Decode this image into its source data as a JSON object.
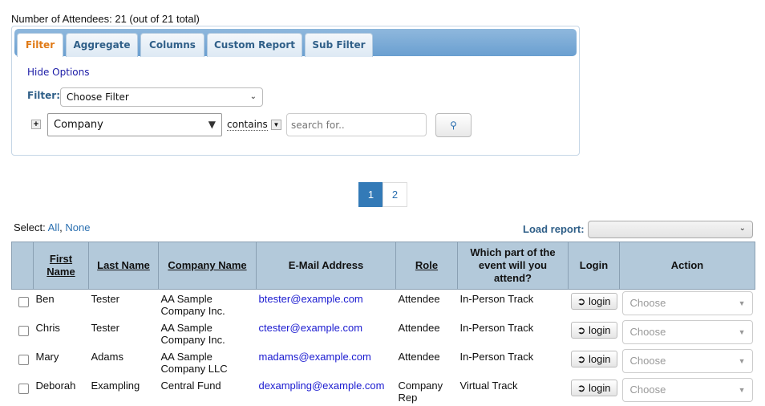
{
  "header": {
    "count_text": "Number of Attendees: 21 (out of 21 total)"
  },
  "tabs": [
    {
      "label": "Filter"
    },
    {
      "label": "Aggregate"
    },
    {
      "label": "Columns"
    },
    {
      "label": "Custom Report"
    },
    {
      "label": "Sub Filter"
    }
  ],
  "filter": {
    "hide_options": "Hide Options",
    "filter_label": "Filter:",
    "choose_filter": "Choose Filter",
    "field": "Company",
    "operator": "contains",
    "search_placeholder": "search for.."
  },
  "pagination": {
    "pages": [
      "1",
      "2"
    ],
    "current": "1"
  },
  "select": {
    "label": "Select:",
    "all": "All",
    "sep": ",",
    "none": "None"
  },
  "load_report": {
    "label": "Load report:",
    "value": ""
  },
  "table": {
    "headers": [
      "First Name",
      "Last Name",
      "Company Name",
      "E-Mail Address",
      "Role",
      "Which part of the event will you attend?",
      "Login",
      "Action"
    ],
    "rows": [
      {
        "first": "Ben",
        "last": "Tester",
        "company": "AA Sample Company Inc.",
        "email": "btester@example.com",
        "role": "Attendee",
        "part": "In-Person Track",
        "login": "login",
        "action": "Choose"
      },
      {
        "first": "Chris",
        "last": "Tester",
        "company": "AA Sample Company Inc.",
        "email": "ctester@example.com",
        "role": "Attendee",
        "part": "In-Person Track",
        "login": "login",
        "action": "Choose"
      },
      {
        "first": "Mary",
        "last": "Adams",
        "company": "AA Sample Company LLC",
        "email": "madams@example.com",
        "role": "Attendee",
        "part": "In-Person Track",
        "login": "login",
        "action": "Choose"
      },
      {
        "first": "Deborah",
        "last": "Exampling",
        "company": "Central Fund",
        "email": "dexampling@example.com",
        "role": "Company Rep",
        "part": "Virtual Track",
        "login": "login",
        "action": "Choose"
      }
    ]
  }
}
